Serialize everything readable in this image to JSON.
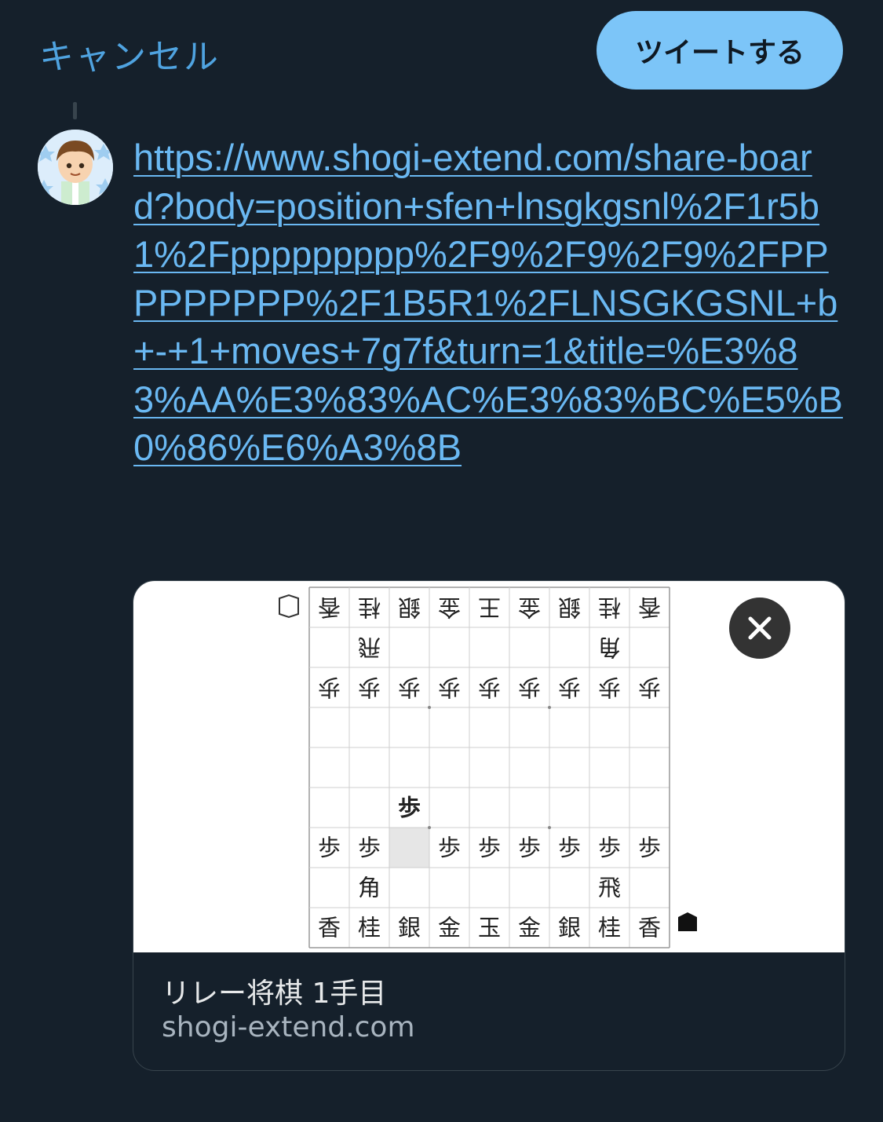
{
  "header": {
    "cancel_label": "キャンセル",
    "tweet_label": "ツイートする"
  },
  "tweet": {
    "text": " https://www.shogi-extend.com/share-board?body=position+sfen+lnsgkgsnl%2F1r5b1%2Fppppppppp%2F9%2F9%2F9%2FPPPPPPPPP%2F1B5R1%2FLNSGKGSNL+b+-+1+moves+7g7f&turn=1&title=%E3%83%AA%E3%83%AC%E3%83%BC%E5%B0%86%E6%A3%8B"
  },
  "card": {
    "title": "リレー将棋 1手目",
    "domain": "shogi-extend.com",
    "board": {
      "ranks": [
        [
          {
            "p": "香",
            "f": true
          },
          {
            "p": "桂",
            "f": true
          },
          {
            "p": "銀",
            "f": true
          },
          {
            "p": "金",
            "f": true
          },
          {
            "p": "王",
            "f": true
          },
          {
            "p": "金",
            "f": true
          },
          {
            "p": "銀",
            "f": true
          },
          {
            "p": "桂",
            "f": true
          },
          {
            "p": "香",
            "f": true
          }
        ],
        [
          {
            "p": ""
          },
          {
            "p": "飛",
            "f": true
          },
          {
            "p": ""
          },
          {
            "p": ""
          },
          {
            "p": ""
          },
          {
            "p": ""
          },
          {
            "p": ""
          },
          {
            "p": "角",
            "f": true
          },
          {
            "p": ""
          }
        ],
        [
          {
            "p": "歩",
            "f": true
          },
          {
            "p": "歩",
            "f": true
          },
          {
            "p": "歩",
            "f": true
          },
          {
            "p": "歩",
            "f": true
          },
          {
            "p": "歩",
            "f": true
          },
          {
            "p": "歩",
            "f": true
          },
          {
            "p": "歩",
            "f": true
          },
          {
            "p": "歩",
            "f": true
          },
          {
            "p": "歩",
            "f": true
          }
        ],
        [
          {
            "p": ""
          },
          {
            "p": ""
          },
          {
            "p": ""
          },
          {
            "p": ""
          },
          {
            "p": ""
          },
          {
            "p": ""
          },
          {
            "p": ""
          },
          {
            "p": ""
          },
          {
            "p": ""
          }
        ],
        [
          {
            "p": ""
          },
          {
            "p": ""
          },
          {
            "p": ""
          },
          {
            "p": ""
          },
          {
            "p": ""
          },
          {
            "p": ""
          },
          {
            "p": ""
          },
          {
            "p": ""
          },
          {
            "p": ""
          }
        ],
        [
          {
            "p": ""
          },
          {
            "p": ""
          },
          {
            "p": "歩",
            "b": true
          },
          {
            "p": ""
          },
          {
            "p": ""
          },
          {
            "p": ""
          },
          {
            "p": ""
          },
          {
            "p": ""
          },
          {
            "p": ""
          }
        ],
        [
          {
            "p": "歩"
          },
          {
            "p": "歩"
          },
          {
            "p": "",
            "h": true
          },
          {
            "p": "歩"
          },
          {
            "p": "歩"
          },
          {
            "p": "歩"
          },
          {
            "p": "歩"
          },
          {
            "p": "歩"
          },
          {
            "p": "歩"
          }
        ],
        [
          {
            "p": ""
          },
          {
            "p": "角"
          },
          {
            "p": ""
          },
          {
            "p": ""
          },
          {
            "p": ""
          },
          {
            "p": ""
          },
          {
            "p": ""
          },
          {
            "p": "飛"
          },
          {
            "p": ""
          }
        ],
        [
          {
            "p": "香"
          },
          {
            "p": "桂"
          },
          {
            "p": "銀"
          },
          {
            "p": "金"
          },
          {
            "p": "玉"
          },
          {
            "p": "金"
          },
          {
            "p": "銀"
          },
          {
            "p": "桂"
          },
          {
            "p": "香"
          }
        ]
      ]
    }
  },
  "colors": {
    "background": "#15202b",
    "link": "#6ab8f2",
    "tweet_button": "#7cc5f8",
    "highlight_square": "#e6e6e6"
  }
}
